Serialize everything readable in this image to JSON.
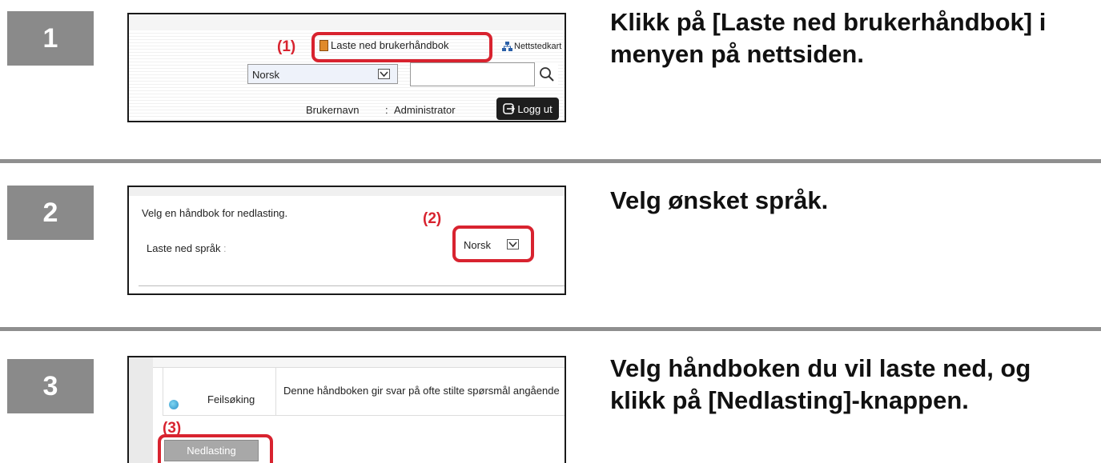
{
  "steps": [
    {
      "number": "1",
      "instruction_line1": "Klikk på [Laste ned brukerhåndbok] i",
      "instruction_line2": "menyen på nettsiden.",
      "callout": "(1)",
      "download_manual_link": "Laste ned brukerhåndbok",
      "sitemap_link": "Nettstedkart",
      "language_select_value": "Norsk",
      "search_placeholder": "",
      "username_label": "Brukernavn",
      "username_separator": ":",
      "username_value": "Administrator",
      "logout_button": "Logg ut"
    },
    {
      "number": "2",
      "instruction": "Velg ønsket språk.",
      "callout": "(2)",
      "heading": "Velg en håndbok for nedlasting.",
      "language_label": "Laste ned språk",
      "language_separator": ":",
      "language_select_value": "Norsk"
    },
    {
      "number": "3",
      "instruction_line1": "Velg håndboken du vil laste ned, og",
      "instruction_line2": "klikk på [Nedlasting]-knappen.",
      "callout": "(3)",
      "manual_name": "Feilsøking",
      "manual_description": "Denne håndboken gir svar på ofte stilte spørsmål angående",
      "download_button": "Nedlasting"
    }
  ],
  "colors": {
    "badge": "#8a8a8a",
    "callout": "#d8232f",
    "divider": "#8f8f8f",
    "logout_bg": "#1e1e1e"
  }
}
